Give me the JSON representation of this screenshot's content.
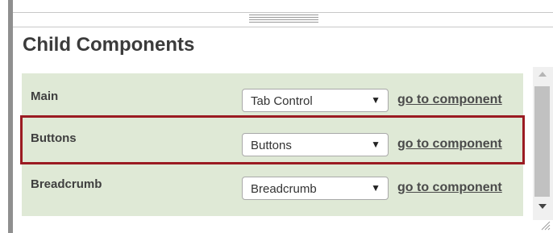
{
  "section": {
    "title": "Child Components"
  },
  "rows": [
    {
      "label": "Main",
      "selected_value": "Tab Control",
      "link_label": "go to component",
      "highlighted": false
    },
    {
      "label": "Buttons",
      "selected_value": "Buttons",
      "link_label": "go to component",
      "highlighted": true
    },
    {
      "label": "Breadcrumb",
      "selected_value": "Breadcrumb",
      "link_label": "go to component",
      "highlighted": false
    }
  ],
  "colors": {
    "panel_background": "#dfe9d6",
    "highlight_border": "#9b1b22"
  },
  "icons": {
    "dropdown": "caret-down-icon",
    "scroll_up": "scroll-up-arrow-icon",
    "scroll_down": "scroll-down-arrow-icon",
    "resize": "resize-grip-icon"
  }
}
